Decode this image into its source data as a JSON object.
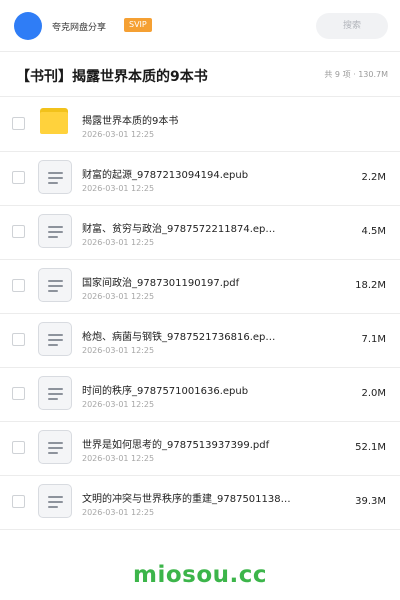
{
  "header": {
    "app_name": "夸克网盘分享",
    "badge": "SVIP",
    "search_placeholder": "搜索"
  },
  "share": {
    "title": "【书刊】揭露世界本质的9本书",
    "summary": "共 9 项 · 130.7M"
  },
  "files": [
    {
      "type": "folder",
      "name": "揭露世界本质的9本书",
      "date": "2026-03-01 12:25",
      "size": ""
    },
    {
      "type": "file",
      "name": "财富的起源_9787213094194.epub",
      "date": "2026-03-01 12:25",
      "size": "2.2M"
    },
    {
      "type": "file",
      "name": "财富、贫穷与政治_9787572211874.ep…",
      "date": "2026-03-01 12:25",
      "size": "4.5M"
    },
    {
      "type": "file",
      "name": "国家间政治_9787301190197.pdf",
      "date": "2026-03-01 12:25",
      "size": "18.2M"
    },
    {
      "type": "file",
      "name": "枪炮、病菌与钢铁_9787521736816.ep…",
      "date": "2026-03-01 12:25",
      "size": "7.1M"
    },
    {
      "type": "file",
      "name": "时间的秩序_9787571001636.epub",
      "date": "2026-03-01 12:25",
      "size": "2.0M"
    },
    {
      "type": "file",
      "name": "世界是如何思考的_9787513937399.pdf",
      "date": "2026-03-01 12:25",
      "size": "52.1M"
    },
    {
      "type": "file",
      "name": "文明的冲突与世界秩序的重建_97875011387…",
      "date": "2026-03-01 12:25",
      "size": "39.3M"
    }
  ],
  "watermark": "miosou.cc",
  "colors": {
    "accent": "#2f7df6",
    "badge": "#f5a033",
    "folder": "#ffd23c",
    "watermark": "#3cb54a"
  },
  "icons": {
    "folder": "folder-icon",
    "file": "document-icon"
  }
}
